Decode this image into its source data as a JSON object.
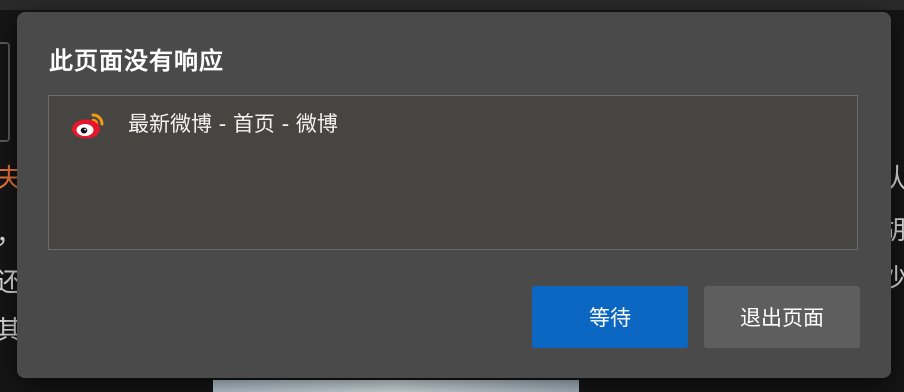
{
  "dialog": {
    "title": "此页面没有响应",
    "tabs": [
      {
        "title": "最新微博 - 首页 - 微博",
        "icon": "weibo-icon"
      }
    ],
    "wait_label": "等待",
    "exit_label": "退出页面"
  },
  "background": {
    "left_fragments": [
      "夫",
      "，",
      "还",
      "其"
    ],
    "right_fragments": [
      "队",
      "胡",
      "沙"
    ]
  },
  "colors": {
    "dialog_bg": "#4a4a4a",
    "primary_button": "#0b67c1",
    "secondary_button": "#5e5e5e",
    "accent_orange": "#e8723a",
    "weibo_red": "#e6162d",
    "weibo_orange": "#f39c12"
  }
}
